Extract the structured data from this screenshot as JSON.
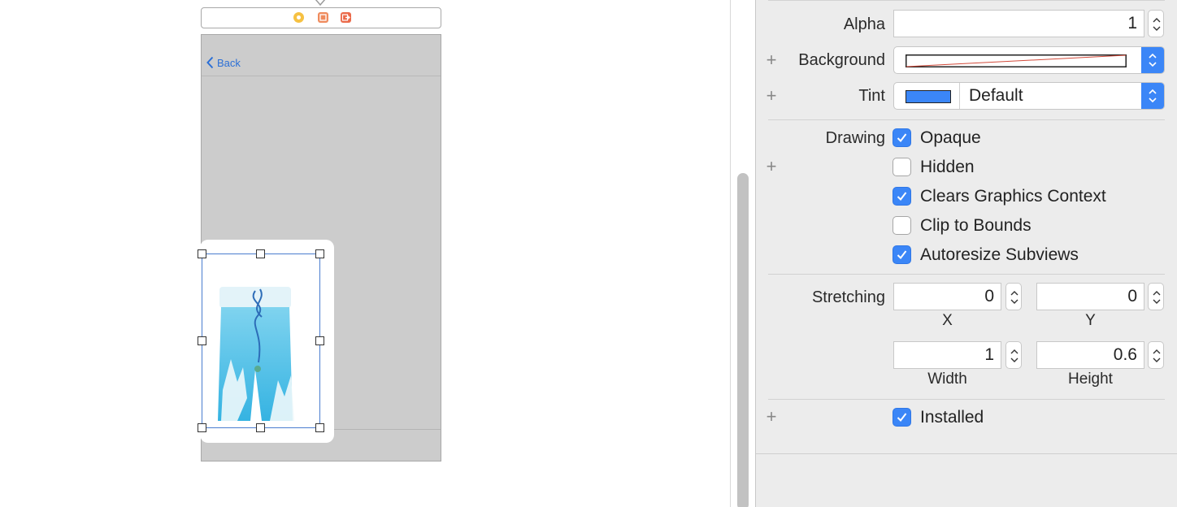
{
  "canvas": {
    "scene_dock": {
      "icons": [
        "view-controller-icon",
        "first-responder-icon",
        "exit-icon"
      ]
    },
    "nav_bar": {
      "back_label": "Back"
    },
    "colors": {
      "screen_bg": "#cccccc",
      "selection": "#4a7dcf",
      "back_tint": "#2b6fd6"
    }
  },
  "inspector": {
    "alpha": {
      "label": "Alpha",
      "value": "1"
    },
    "background": {
      "label": "Background",
      "color_value": "clear"
    },
    "tint": {
      "label": "Tint",
      "value": "Default",
      "swatch": "#3b86f7"
    },
    "drawing": {
      "label": "Drawing",
      "options": [
        {
          "label": "Opaque",
          "checked": true
        },
        {
          "label": "Hidden",
          "checked": false
        },
        {
          "label": "Clears Graphics Context",
          "checked": true
        },
        {
          "label": "Clip to Bounds",
          "checked": false
        },
        {
          "label": "Autoresize Subviews",
          "checked": true
        }
      ]
    },
    "stretching": {
      "label": "Stretching",
      "x": {
        "label": "X",
        "value": "0"
      },
      "y": {
        "label": "Y",
        "value": "0"
      },
      "width": {
        "label": "Width",
        "value": "1"
      },
      "height": {
        "label": "Height",
        "value": "0.6"
      }
    },
    "installed": {
      "label": "Installed",
      "checked": true
    },
    "colors": {
      "accent": "#3b86f7"
    }
  }
}
